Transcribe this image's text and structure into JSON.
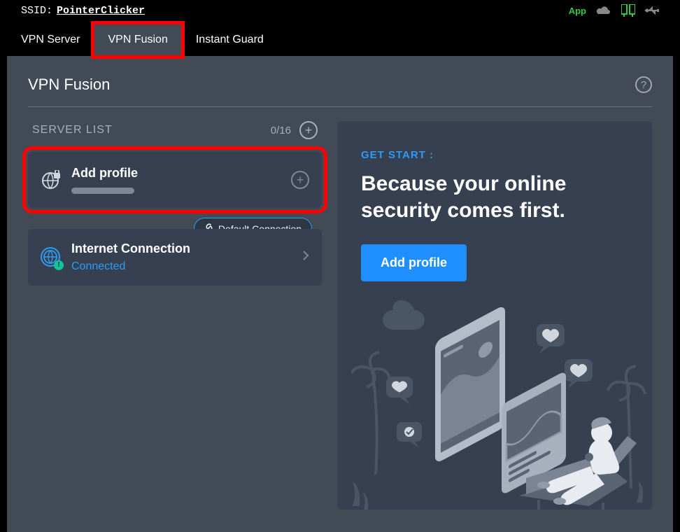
{
  "top": {
    "ssid_label": "SSID:",
    "ssid_value": "PointerClicker",
    "app_label": "App"
  },
  "tabs": {
    "items": [
      {
        "label": "VPN Server"
      },
      {
        "label": "VPN Fusion"
      },
      {
        "label": "Instant Guard"
      }
    ]
  },
  "page": {
    "title": "VPN Fusion"
  },
  "server_list": {
    "header": "SERVER LIST",
    "count": "0/16",
    "add_profile_label": "Add profile"
  },
  "internet": {
    "badge": "Default Connection",
    "title": "Internet Connection",
    "status": "Connected"
  },
  "right": {
    "get_start": "GET START :",
    "hero_line1": "Because your online",
    "hero_line2": "security comes first.",
    "add_button": "Add profile"
  }
}
